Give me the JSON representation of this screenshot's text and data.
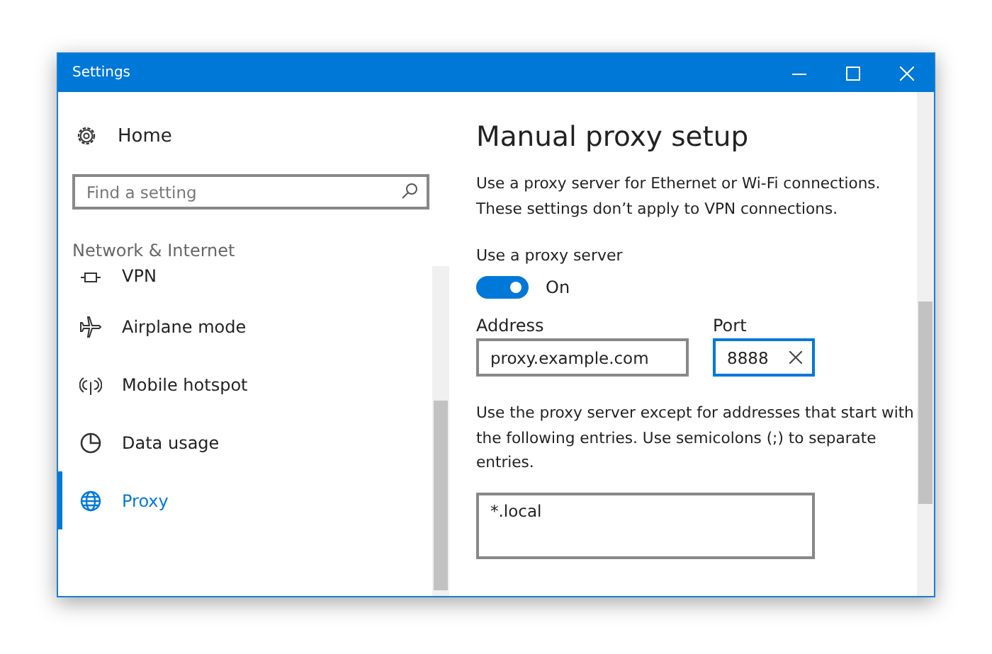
{
  "window": {
    "title": "Settings"
  },
  "sidebar": {
    "home": "Home",
    "search": {
      "placeholder": "Find a setting"
    },
    "section": "Network & Internet",
    "items": [
      {
        "label": "VPN",
        "selected": false
      },
      {
        "label": "Airplane mode",
        "selected": false
      },
      {
        "label": "Mobile hotspot",
        "selected": false
      },
      {
        "label": "Data usage",
        "selected": false
      },
      {
        "label": "Proxy",
        "selected": true
      }
    ]
  },
  "content": {
    "title": "Manual proxy setup",
    "description": "Use a proxy server for Ethernet or Wi-Fi connections. These settings don’t apply to VPN connections.",
    "toggle": {
      "label": "Use a proxy server",
      "on": true,
      "state_text": "On"
    },
    "address": {
      "label": "Address",
      "value": "proxy.example.com"
    },
    "port": {
      "label": "Port",
      "value": "8888"
    },
    "exceptions_text": "Use the proxy server except for addresses that start with the following entries. Use semicolons (;) to separate entries.",
    "exceptions": {
      "value": "*.local"
    }
  }
}
